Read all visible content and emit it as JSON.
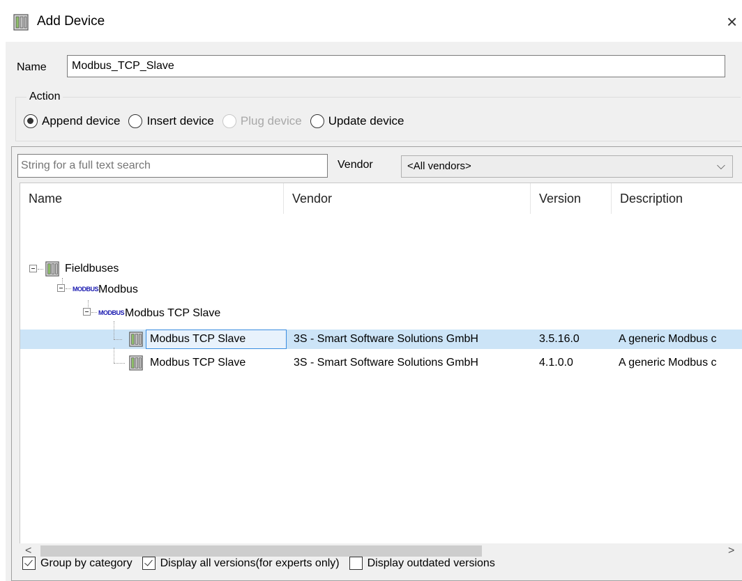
{
  "window": {
    "title": "Add Device",
    "close_glyph": "×"
  },
  "name_field": {
    "label": "Name",
    "value": "Modbus_TCP_Slave"
  },
  "action": {
    "legend": "Action",
    "options": [
      {
        "label": "Append device",
        "checked": true,
        "disabled": false
      },
      {
        "label": "Insert device",
        "checked": false,
        "disabled": false
      },
      {
        "label": "Plug device",
        "checked": false,
        "disabled": true
      },
      {
        "label": "Update device",
        "checked": false,
        "disabled": false
      }
    ]
  },
  "search": {
    "placeholder": "String for a full text search"
  },
  "vendor": {
    "label": "Vendor",
    "selected": "<All vendors>"
  },
  "columns": [
    "Name",
    "Vendor",
    "Version",
    "Description"
  ],
  "tree": {
    "fieldbuses": "Fieldbuses",
    "modbus": "Modbus",
    "modbus_tcp_slave_group": "Modbus TCP Slave",
    "modbus_icon_text": "MODBUS",
    "devices": [
      {
        "name": "Modbus TCP Slave",
        "vendor": "3S - Smart Software Solutions GmbH",
        "version": "3.5.16.0",
        "description": "A generic Modbus c",
        "selected": true
      },
      {
        "name": "Modbus TCP Slave",
        "vendor": "3S - Smart Software Solutions GmbH",
        "version": "4.1.0.0",
        "description": "A generic Modbus c",
        "selected": false
      }
    ]
  },
  "options": {
    "group_by_category": {
      "label": "Group by category",
      "checked": true
    },
    "display_all_versions": {
      "label": "Display all versions(for experts only)",
      "checked": true
    },
    "display_outdated": {
      "label": "Display outdated versions",
      "checked": false
    }
  },
  "colors": {
    "selection": "#cce4f7",
    "selection_border": "#3a8de0",
    "modbus_blue": "#1a1ab0"
  }
}
